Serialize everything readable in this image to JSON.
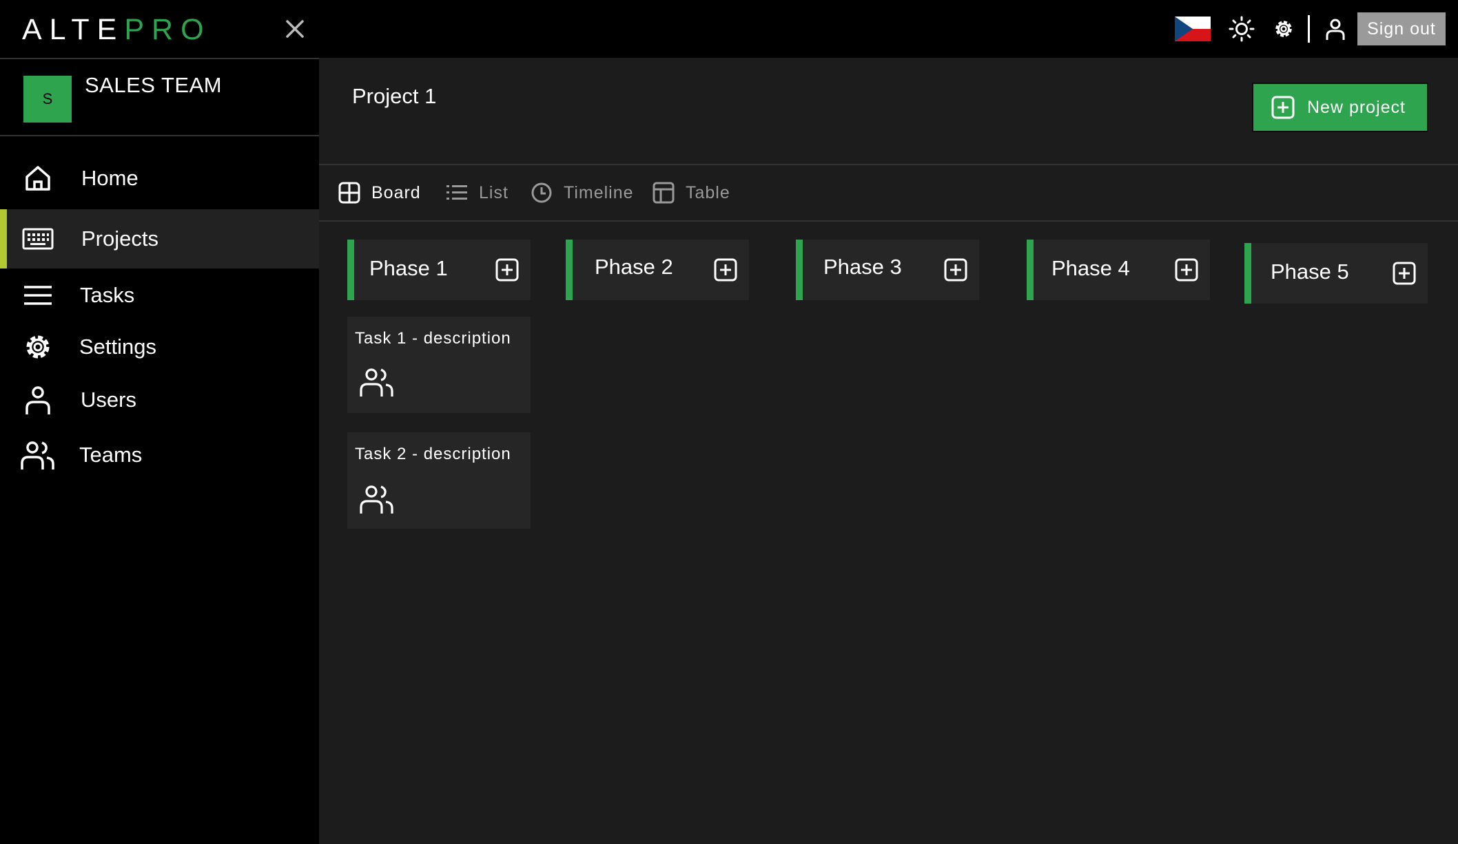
{
  "brand": {
    "logo_left": "ALTE",
    "logo_right": "PRO",
    "accent": "#2ea44f",
    "active_marker": "#b3c833"
  },
  "topbar": {
    "language_flag": "cz-flag",
    "sign_out_label": "Sign out"
  },
  "sidebar": {
    "team": {
      "avatar_letter": "S",
      "name": "SALES TEAM"
    },
    "items": [
      {
        "label": "Home",
        "icon": "home-icon"
      },
      {
        "label": "Projects",
        "icon": "keyboard-icon",
        "active": true
      },
      {
        "label": "Tasks",
        "icon": "menu-icon"
      },
      {
        "label": "Settings",
        "icon": "gear-icon"
      },
      {
        "label": "Users",
        "icon": "user-icon"
      },
      {
        "label": "Teams",
        "icon": "users-icon"
      }
    ]
  },
  "main": {
    "title": "Project 1",
    "new_project_label": "New project",
    "views": [
      {
        "label": "Board",
        "icon": "board-icon",
        "active": true
      },
      {
        "label": "List",
        "icon": "list-icon"
      },
      {
        "label": "Timeline",
        "icon": "clock-icon"
      },
      {
        "label": "Table",
        "icon": "table-icon"
      }
    ],
    "phases": [
      {
        "label": "Phase 1"
      },
      {
        "label": "Phase 2"
      },
      {
        "label": "Phase 3"
      },
      {
        "label": "Phase 4"
      },
      {
        "label": "Phase 5"
      }
    ],
    "tasks": [
      {
        "text": "Task 1 - description",
        "phase": "Phase 1"
      },
      {
        "text": "Task 2 - description",
        "phase": "Phase 1"
      }
    ]
  }
}
